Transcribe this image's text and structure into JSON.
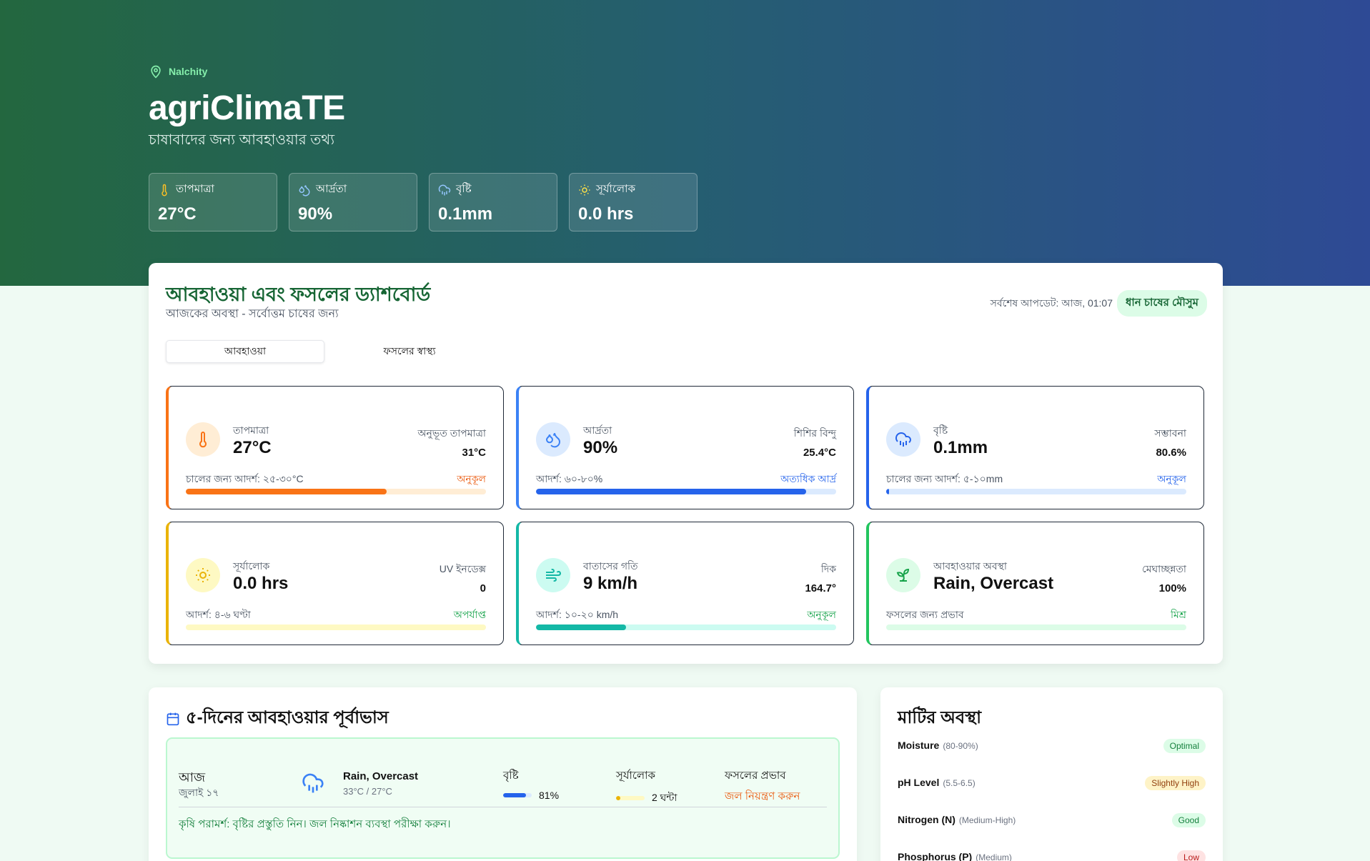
{
  "header": {
    "location": "Nalchity",
    "title": "agriClimaTE",
    "subtitle": "চাষাবাদের জন্য আবহাওয়ার তথ্য",
    "stats": [
      {
        "label": "তাপমাত্রা",
        "value": "27°C",
        "icon": "thermometer-icon"
      },
      {
        "label": "আর্দ্রতা",
        "value": "90%",
        "icon": "droplets-icon"
      },
      {
        "label": "বৃষ্টি",
        "value": "0.1mm",
        "icon": "cloud-rain-icon"
      },
      {
        "label": "সূর্যালোক",
        "value": "0.0 hrs",
        "icon": "sun-icon"
      }
    ]
  },
  "dashboard": {
    "title": "আবহাওয়া এবং ফসলের ড্যাশবোর্ড",
    "subtitle": "আজকের অবস্থা - সর্বোত্তম চাষের জন্য",
    "updated": "সর্বশেষ আপডেট: আজ, 01:07",
    "season": "ধান চাষের মৌসুম",
    "tabs": [
      "আবহাওয়া",
      "ফসলের স্বাস্থ্য"
    ],
    "cards": [
      {
        "label": "তাপমাত্রা",
        "value": "27°C",
        "side_label": "অনুভূত তাপমাত্রা",
        "side_value": "31°C",
        "footer": "চালের জন্য আদর্শ: ২৫-৩০°C",
        "status": "অনুকূল",
        "progress": 0.67,
        "accent": "#f97316",
        "icon": "thermometer-icon"
      },
      {
        "label": "আর্দ্রতা",
        "value": "90%",
        "side_label": "শিশির বিন্দু",
        "side_value": "25.4°C",
        "footer": "আদর্শ: ৬০-৮০%",
        "status": "অত্যধিক আর্দ্র",
        "progress": 0.9,
        "accent": "#3b82f6",
        "icon": "droplets-icon"
      },
      {
        "label": "বৃষ্টি",
        "value": "0.1mm",
        "side_label": "সম্ভাবনা",
        "side_value": "80.6%",
        "footer": "চালের জন্য আদর্শ: ৫-১০mm",
        "status": "অনুকূল",
        "progress": 0.01,
        "accent": "#2563eb",
        "icon": "cloud-rain-icon"
      },
      {
        "label": "সূর্যালোক",
        "value": "0.0 hrs",
        "side_label": "UV ইনডেক্স",
        "side_value": "0",
        "footer": "আদর্শ: ৪-৬ ঘণ্টা",
        "status": "অপর্যাপ্ত",
        "progress": 0.0,
        "accent": "#eab308",
        "icon": "sun-icon"
      },
      {
        "label": "বাতাসের গতি",
        "value": "9 km/h",
        "side_label": "দিক",
        "side_value": "164.7°",
        "footer": "আদর্শ: ১০-২০ km/h",
        "status": "অনুকূল",
        "progress": 0.3,
        "accent": "#14b8a6",
        "icon": "wind-icon"
      },
      {
        "label": "আবহাওয়ার অবস্থা",
        "value": "Rain, Overcast",
        "side_label": "মেঘাচ্ছন্নতা",
        "side_value": "100%",
        "footer": "ফসলের জন্য প্রভাব",
        "status": "মিশ্র",
        "progress": 0.0,
        "accent": "#22c55e",
        "icon": "sprout-icon"
      }
    ]
  },
  "forecast": {
    "title": "৫-দিনের আবহাওয়ার পূর্বাভাস",
    "days": [
      {
        "name": "আজ",
        "date": "জুলাই ১৭",
        "condition": "Rain, Overcast",
        "temps": "33°C / 27°C",
        "rain_label": "বৃষ্টি",
        "rain_value": "81%",
        "rain_progress": 0.81,
        "sun_label": "সূর্যালোক",
        "sun_value": "2 ঘন্টা",
        "sun_progress": 0.15,
        "impact_label": "ফসলের প্রভাব",
        "impact_value": "জল নিয়ন্ত্রণ করুন",
        "advice": "কৃষি পরামর্শ: বৃষ্টির প্রস্তুতি নিন। জল নিষ্কাশন ব্যবস্থা পরীক্ষা করুন।"
      }
    ]
  },
  "soil": {
    "title": "মাটির অবস্থা",
    "rows": [
      {
        "name": "Moisture",
        "range": "(80-90%)",
        "badge": "Optimal",
        "bg": "#dcfce7",
        "fg": "#15803d"
      },
      {
        "name": "pH Level",
        "range": "(5.5-6.5)",
        "badge": "Slightly High",
        "bg": "#fef3c7",
        "fg": "#92400e"
      },
      {
        "name": "Nitrogen (N)",
        "range": "(Medium-High)",
        "badge": "Good",
        "bg": "#dcfce7",
        "fg": "#15803d"
      },
      {
        "name": "Phosphorus (P)",
        "range": "(Medium)",
        "badge": "Low",
        "bg": "#fee2e2",
        "fg": "#b91c1c"
      }
    ]
  }
}
